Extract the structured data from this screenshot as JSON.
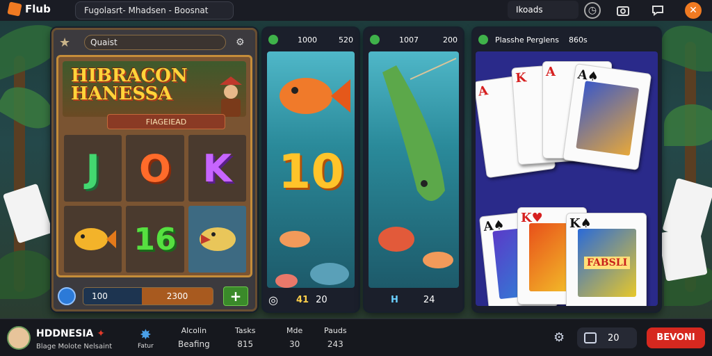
{
  "topbar": {
    "logo_text": "Flub",
    "pill_text": "Fugolasrt-  Mhadsen  -  Boosnat",
    "search_text": "Ikoads",
    "icons": [
      "clock-icon",
      "camera-icon",
      "chat-icon",
      "close-icon"
    ]
  },
  "slot": {
    "search_placeholder": "Quaist",
    "title_line1": "HIBRACON",
    "title_line2": "HANESSA",
    "subtitle": "FIAGEIEAD",
    "reels": [
      "J",
      "O",
      "K",
      "fish",
      "16",
      "fish"
    ],
    "bet_left": "100",
    "bet_right": "2300",
    "plus_label": "+"
  },
  "fish1": {
    "head_v1": "1000",
    "head_v2": "520",
    "big_number": "10",
    "foot_v1": "41",
    "foot_v2": "20"
  },
  "fish2": {
    "head_v1": "1007",
    "head_v2": "200",
    "foot_v1": "H",
    "foot_v2": "24"
  },
  "cards": {
    "head_text": "Plasshe  Perglens",
    "head_value": "860s",
    "card_art_text": "FABSLI"
  },
  "bottombar": {
    "user_name": "HDDNESIA",
    "user_sub": "Blage Molote Nelsaint",
    "center_label": "Fatur",
    "stats": [
      {
        "label": "Alcolin",
        "value": "Beafing"
      },
      {
        "label": "Tasks",
        "value": "815"
      },
      {
        "label": "Mde",
        "value": "30"
      },
      {
        "label": "Pauds",
        "value": "243"
      }
    ],
    "counter_value": "20",
    "cta_label": "BEVONI"
  }
}
